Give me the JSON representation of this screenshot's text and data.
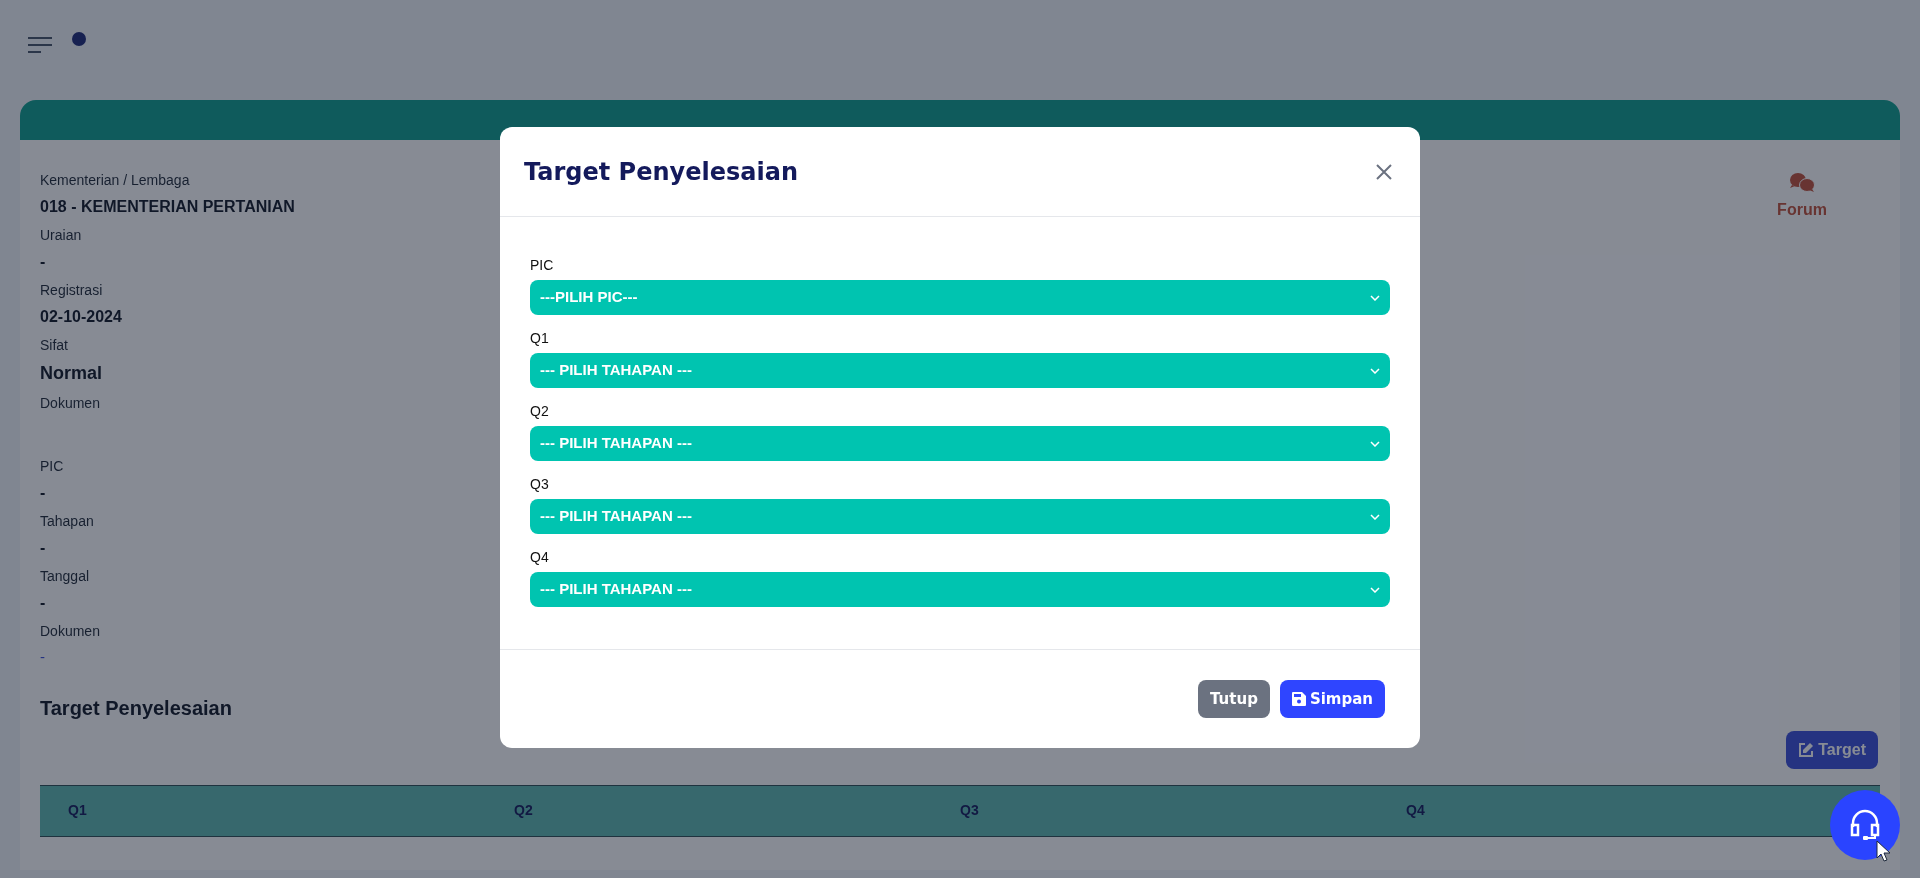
{
  "detail": {
    "fields": [
      {
        "label": "Kementerian / Lembaga",
        "value": "018 - KEMENTERIAN PERTANIAN",
        "kind": "text"
      },
      {
        "label": "Uraian",
        "value": "-",
        "kind": "text"
      },
      {
        "label": "Registrasi",
        "value": "02-10-2024",
        "kind": "text"
      },
      {
        "label": "Sifat",
        "value": "Normal",
        "kind": "large"
      },
      {
        "label": "Dokumen",
        "kind": "empty"
      },
      {
        "label": "PIC",
        "value": "-",
        "kind": "text"
      },
      {
        "label": "Tahapan",
        "value": "-",
        "kind": "text"
      },
      {
        "label": "Tanggal",
        "value": "-",
        "kind": "text"
      },
      {
        "label": "Dokumen",
        "value": "-",
        "kind": "link"
      }
    ]
  },
  "forum": {
    "label": "Forum"
  },
  "section_title": "Target Penyelesaian",
  "target_button": {
    "label": "Target"
  },
  "table": {
    "columns": [
      "Q1",
      "Q2",
      "Q3",
      "Q4"
    ]
  },
  "modal": {
    "title": "Target Penyelesaian",
    "fields": [
      {
        "label": "PIC",
        "value": "---PILIH PIC---"
      },
      {
        "label": "Q1",
        "value": "--- PILIH TAHAPAN ---"
      },
      {
        "label": "Q2",
        "value": "--- PILIH TAHAPAN ---"
      },
      {
        "label": "Q3",
        "value": "--- PILIH TAHAPAN ---"
      },
      {
        "label": "Q4",
        "value": "--- PILIH TAHAPAN ---"
      }
    ],
    "buttons": [
      {
        "label": "Tutup",
        "kind": "secondary"
      },
      {
        "label": "Simpan",
        "kind": "primary"
      }
    ]
  }
}
